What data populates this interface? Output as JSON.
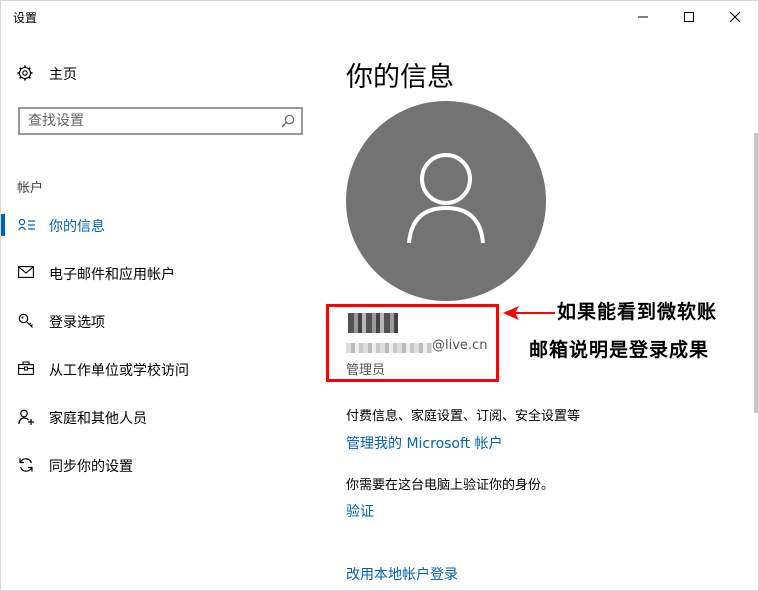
{
  "window": {
    "title": "设置",
    "controls": {
      "minimize": "minimize-icon",
      "maximize": "maximize-icon",
      "close": "close-icon"
    }
  },
  "sidebar": {
    "home_label": "主页",
    "search_placeholder": "查找设置",
    "section_label": "帐户",
    "items": [
      {
        "label": "你的信息",
        "icon": "user-card-icon",
        "active": true
      },
      {
        "label": "电子邮件和应用帐户",
        "icon": "mail-icon",
        "active": false
      },
      {
        "label": "登录选项",
        "icon": "key-icon",
        "active": false
      },
      {
        "label": "从工作单位或学校访问",
        "icon": "briefcase-icon",
        "active": false
      },
      {
        "label": "家庭和其他人员",
        "icon": "person-add-icon",
        "active": false
      },
      {
        "label": "同步你的设置",
        "icon": "sync-icon",
        "active": false
      }
    ]
  },
  "main": {
    "title": "你的信息",
    "account": {
      "email_suffix": "@live.cn",
      "role": "管理员"
    },
    "billing_text": "付费信息、家庭设置、订阅、安全设置等",
    "manage_link": "管理我的 Microsoft 帐户",
    "verify_text": "你需要在这台电脑上验证你的身份。",
    "verify_link": "验证",
    "local_login_link": "改用本地帐户登录"
  },
  "annotation": {
    "line1": "如果能看到微软账",
    "line2": "邮箱说明是登录成果",
    "color": "#ff0000"
  },
  "colors": {
    "accent": "#0063b1",
    "avatar_bg": "#737373"
  }
}
